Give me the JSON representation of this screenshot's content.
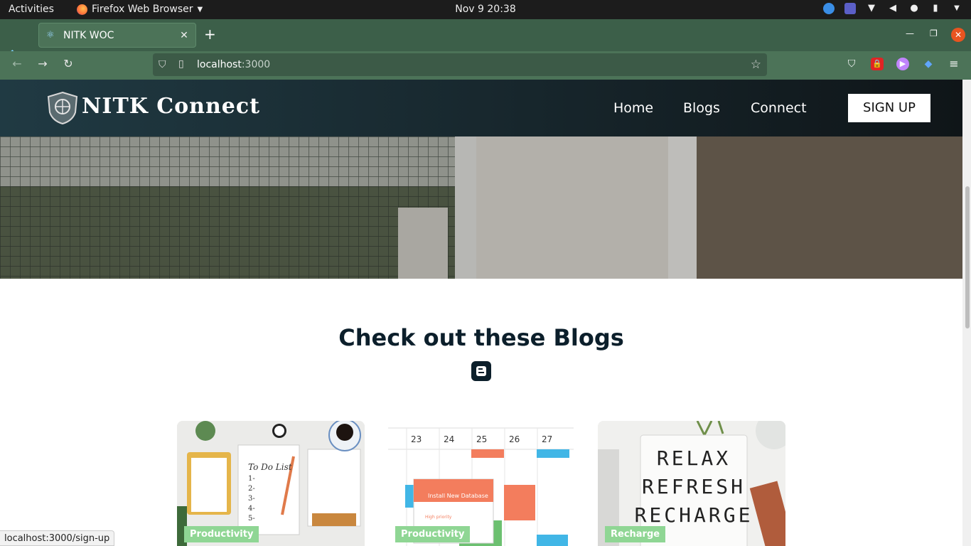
{
  "os": {
    "activities": "Activities",
    "app_name": "Firefox Web Browser",
    "clock": "Nov 9  20:38"
  },
  "browser": {
    "tab_title": "NITK WOC",
    "url_host": "localhost",
    "url_port": ":3000",
    "status_url": "localhost:3000/sign-up"
  },
  "site": {
    "brand": "NITK Connect",
    "nav": {
      "home": "Home",
      "blogs": "Blogs",
      "connect": "Connect",
      "signup": "SIGN UP"
    },
    "section_title": "Check out these Blogs",
    "cards": [
      {
        "tag": "Productivity",
        "image": "to-do-list-desk"
      },
      {
        "tag": "Productivity",
        "image": "calendar-install-new-database",
        "popup_text": "Install New Database",
        "days": [
          "23",
          "24",
          "25",
          "26",
          "27"
        ]
      },
      {
        "tag": "Recharge",
        "image": "relax-refresh-recharge-lightbox",
        "words": [
          "RELAX",
          "REFRESH",
          "RECHARGE"
        ]
      }
    ],
    "card_texts": {
      "todo": "To Do List",
      "todo_items": [
        "1-",
        "2-",
        "3-",
        "4-",
        "5-"
      ],
      "high_priority": "High priority"
    }
  },
  "colors": {
    "accent": "#4c7358",
    "header_dark": "#17262c",
    "tag_green": "#8fd694",
    "heading": "#0c1f2b"
  }
}
